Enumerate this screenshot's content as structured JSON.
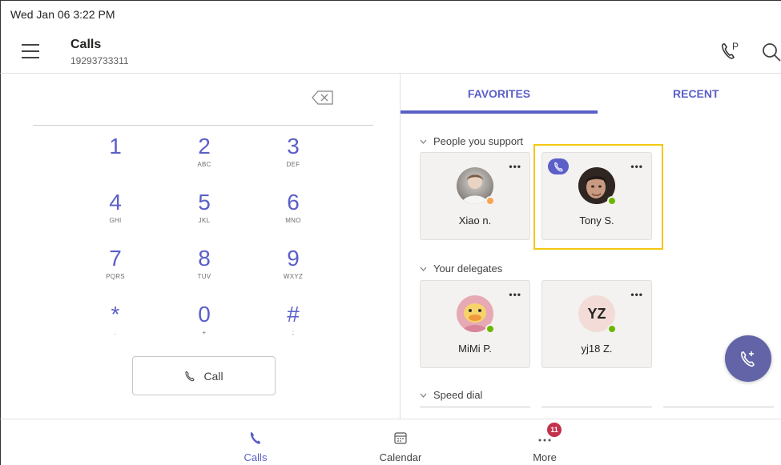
{
  "status_bar": {
    "datetime": "Wed Jan 06  3:22 PM"
  },
  "header": {
    "title": "Calls",
    "subtitle": "19293733311",
    "icons": [
      "menu-icon",
      "call-park-icon",
      "search-icon"
    ]
  },
  "dialpad": {
    "keys": [
      {
        "digit": "1",
        "letters": ""
      },
      {
        "digit": "2",
        "letters": "ABC"
      },
      {
        "digit": "3",
        "letters": "DEF"
      },
      {
        "digit": "4",
        "letters": "GHI"
      },
      {
        "digit": "5",
        "letters": "JKL"
      },
      {
        "digit": "6",
        "letters": "MNO"
      },
      {
        "digit": "7",
        "letters": "PQRS"
      },
      {
        "digit": "8",
        "letters": "TUV"
      },
      {
        "digit": "9",
        "letters": "WXYZ"
      },
      {
        "digit": "*",
        "letters": "."
      },
      {
        "digit": "0",
        "letters": "+"
      },
      {
        "digit": "#",
        "letters": ";"
      }
    ],
    "call_label": "Call"
  },
  "tabs": {
    "favorites": "FAVORITES",
    "recent": "RECENT",
    "active": "favorites"
  },
  "sections": {
    "support": "People you support",
    "delegates": "Your delegates",
    "speed_dial": "Speed dial"
  },
  "contacts": {
    "support": [
      {
        "name": "Xiao n.",
        "presence": "away",
        "more": "•••"
      },
      {
        "name": "Tony S.",
        "presence": "available",
        "more": "•••",
        "in_call": true,
        "focused": true
      }
    ],
    "delegates": [
      {
        "name": "MiMi P.",
        "presence": "available",
        "more": "•••"
      },
      {
        "name": "yj18 Z.",
        "initials": "YZ",
        "presence": "available",
        "more": "•••"
      }
    ]
  },
  "bottom_nav": {
    "calls": "Calls",
    "calendar": "Calendar",
    "more": "More",
    "more_badge": "11",
    "active": "calls"
  },
  "colors": {
    "accent": "#5b5fc7",
    "focus": "#f2c811",
    "available": "#6bb700",
    "away": "#f8a44c",
    "badge": "#c4314b"
  }
}
